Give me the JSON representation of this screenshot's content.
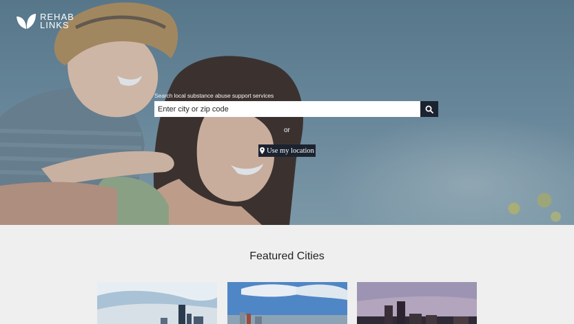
{
  "brand": {
    "line1": "REHAB",
    "line2": "LINKS"
  },
  "search": {
    "label": "Search local substance abuse support services",
    "placeholder": "Enter city or zip code"
  },
  "or_text": "or",
  "location_button": "Use my location",
  "featured": {
    "title": "Featured Cities",
    "cities": [
      {
        "name": ""
      },
      {
        "name": ""
      },
      {
        "name": ""
      }
    ]
  },
  "colors": {
    "dark_button": "#1c2330",
    "page_background": "#efefef",
    "hero_sky": "#6f8fa2"
  }
}
